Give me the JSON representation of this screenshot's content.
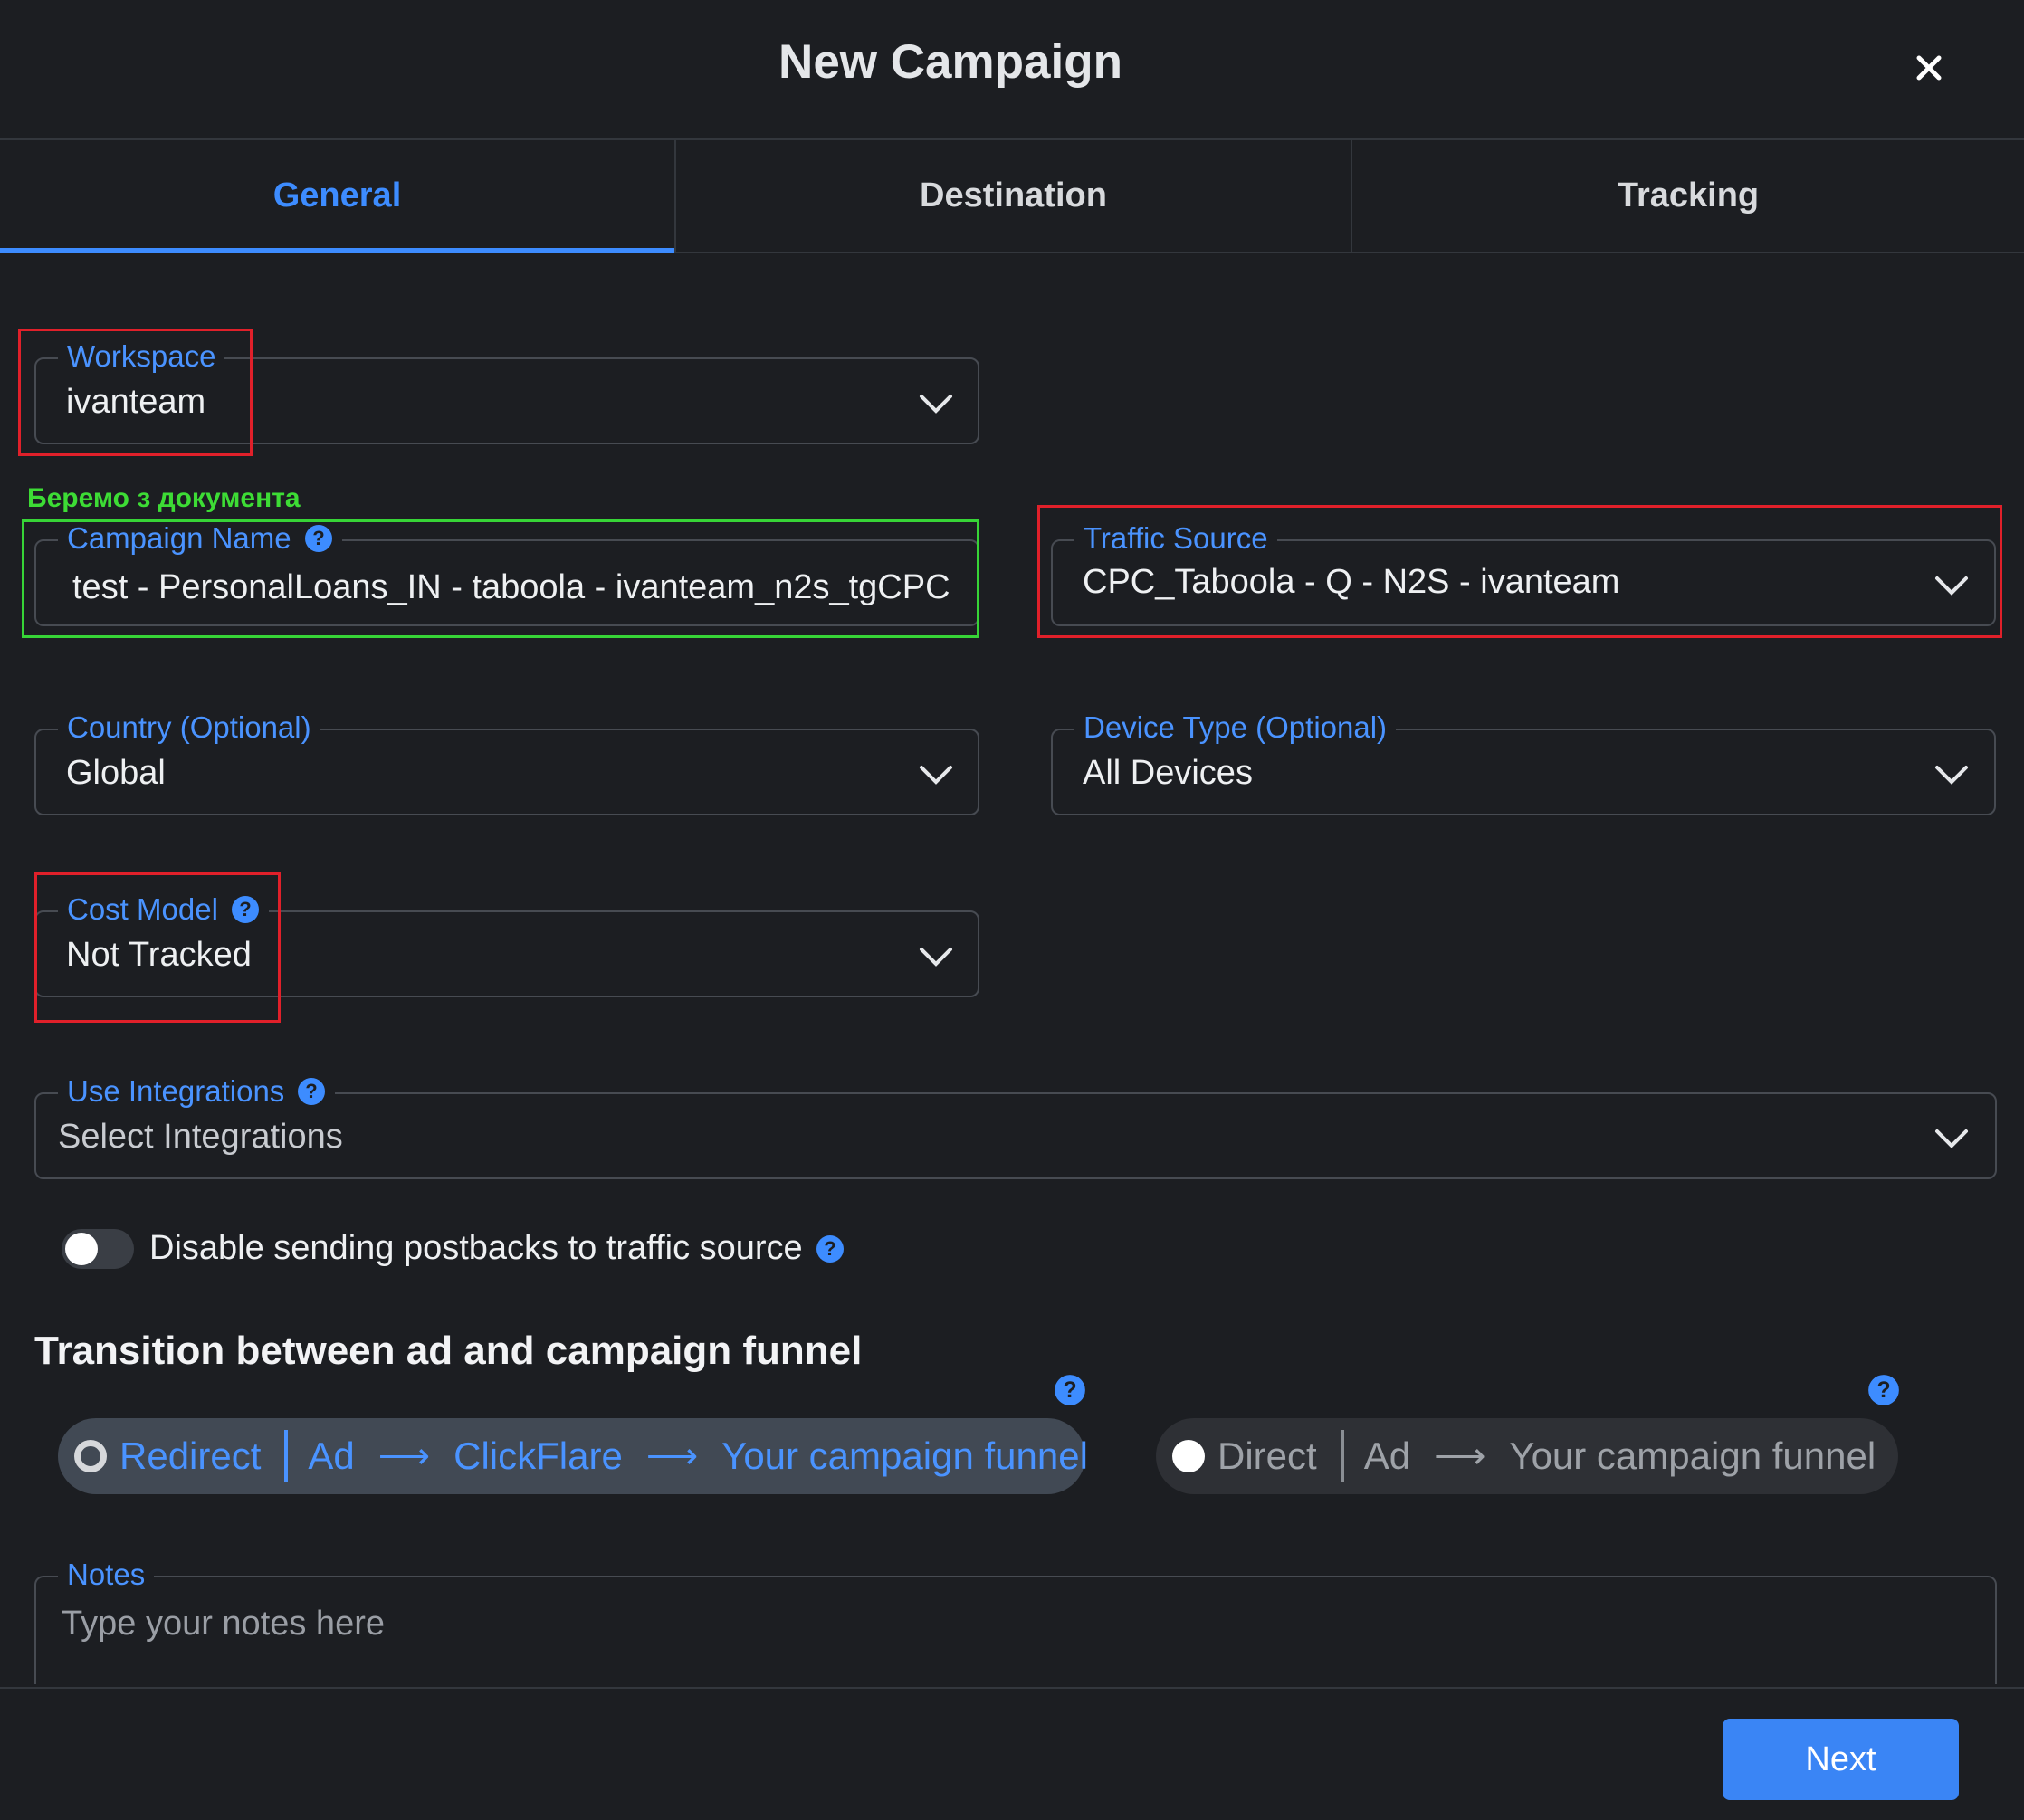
{
  "modal": {
    "title": "New Campaign"
  },
  "tabs": [
    {
      "label": "General",
      "active": true
    },
    {
      "label": "Destination",
      "active": false
    },
    {
      "label": "Tracking",
      "active": false
    }
  ],
  "annotation": {
    "note": "Беремо з документа"
  },
  "fields": {
    "workspace": {
      "label": "Workspace",
      "value": "ivanteam"
    },
    "campaign_name": {
      "label": "Campaign Name",
      "value": "test - PersonalLoans_IN - taboola - ivanteam_n2s_tgCPC"
    },
    "traffic_source": {
      "label": "Traffic Source",
      "value": "CPC_Taboola - Q - N2S - ivanteam"
    },
    "country": {
      "label": "Country (Optional)",
      "value": "Global"
    },
    "device_type": {
      "label": "Device Type (Optional)",
      "value": "All Devices"
    },
    "cost_model": {
      "label": "Cost Model",
      "value": "Not Tracked"
    },
    "integrations": {
      "label": "Use Integrations",
      "placeholder": "Select Integrations"
    }
  },
  "postback_toggle": {
    "label": "Disable sending postbacks to traffic source",
    "on": false
  },
  "transition": {
    "title": "Transition between ad and campaign funnel",
    "redirect": {
      "label": "Redirect",
      "flow": [
        "Ad",
        "ClickFlare",
        "Your campaign funnel"
      ],
      "selected": true
    },
    "direct": {
      "label": "Direct",
      "flow": [
        "Ad",
        "Your campaign funnel"
      ],
      "selected": false
    }
  },
  "notes": {
    "label": "Notes",
    "placeholder": "Type your notes here"
  },
  "footer": {
    "next_label": "Next"
  },
  "colors": {
    "accent": "#3d8cff",
    "highlight_red": "#e0202a",
    "highlight_green": "#37d437",
    "background": "#1c1e22"
  },
  "icons": {
    "close": "close-icon",
    "help": "help-icon",
    "dropdown": "chevron-down-icon",
    "arrow": "arrow-right-icon"
  }
}
